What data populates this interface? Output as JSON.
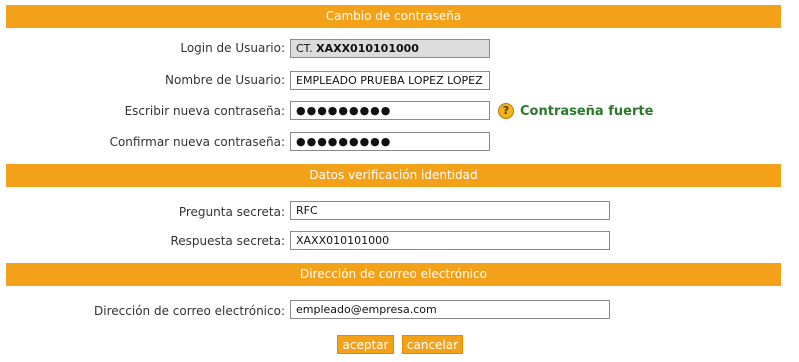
{
  "sections": {
    "password_change": "Cambio de contraseña",
    "identity_verification": "Datos verificación identidad",
    "email": "Dirección de correo electrónico"
  },
  "password_form": {
    "login_label": "Login de Usuario:",
    "login_prefix": "CT.",
    "login_value": "XAXX010101000",
    "name_label": "Nombre de Usuario:",
    "name_value": "EMPLEADO PRUEBA LOPEZ LOPEZ",
    "new_password_label": "Escribir nueva contraseña:",
    "new_password_mask": "●●●●●●●●●",
    "confirm_password_label": "Confirmar nueva contraseña:",
    "confirm_password_mask": "●●●●●●●●●",
    "strength_text": "Contraseña fuerte",
    "strength_icon": "question-icon"
  },
  "identity_form": {
    "question_label": "Pregunta secreta:",
    "question_value": "RFC",
    "answer_label": "Respuesta secreta:",
    "answer_value": "XAXX010101000"
  },
  "email_form": {
    "email_label": "Dirección de correo electrónico:",
    "email_value": "empleado@empresa.com"
  },
  "buttons": {
    "accept": "aceptar",
    "cancel": "cancelar"
  },
  "colors": {
    "band": "#f4a11a",
    "strength_good": "#2a7a2a"
  }
}
